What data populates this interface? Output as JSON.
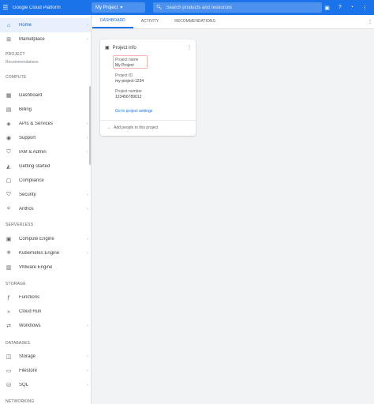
{
  "topbar": {
    "menu_icon": "hamburger-icon",
    "brand": "Google Cloud Platform",
    "project": "My Project",
    "search_placeholder": "Search products and resources",
    "icons": [
      "gift-icon",
      "help-icon",
      "bell-icon",
      "more-icon"
    ]
  },
  "sidebar": {
    "top": [
      {
        "label": "Home",
        "icon": "home-icon",
        "active": true
      },
      {
        "label": "Marketplace",
        "icon": "cart-icon",
        "active": false
      }
    ],
    "project_section": {
      "label": "PROJECT",
      "sub": "Recommendations"
    },
    "compute_label": "COMPUTE",
    "compute": [
      {
        "label": "Dashboard",
        "icon": "grid-icon"
      },
      {
        "label": "Billing",
        "icon": "billing-icon"
      },
      {
        "label": "APIs & Services",
        "icon": "api-icon"
      },
      {
        "label": "Support",
        "icon": "support-icon"
      },
      {
        "label": "IAM & Admin",
        "icon": "shield-icon"
      },
      {
        "label": "Getting started",
        "icon": "rocket-icon"
      },
      {
        "label": "Compliance",
        "icon": "check-icon"
      },
      {
        "label": "Security",
        "icon": "lock-icon"
      },
      {
        "label": "Anthos",
        "icon": "anthos-icon"
      }
    ],
    "serverless_label": "SERVERLESS",
    "serverless": [
      {
        "label": "Compute Engine",
        "icon": "chip-icon"
      },
      {
        "label": "Kubernetes Engine",
        "icon": "cluster-icon"
      },
      {
        "label": "VMware Engine",
        "icon": "server-icon"
      }
    ],
    "storage_label": "STORAGE",
    "storage": [
      {
        "label": "Functions",
        "icon": "function-icon"
      },
      {
        "label": "Cloud Run",
        "icon": "run-icon"
      },
      {
        "label": "Workflows",
        "icon": "flow-icon"
      }
    ],
    "databases_label": "DATABASES",
    "databases": [
      {
        "label": "Storage",
        "icon": "bucket-icon"
      },
      {
        "label": "Filestore",
        "icon": "folder-icon"
      },
      {
        "label": "SQL",
        "icon": "database-icon"
      }
    ],
    "networking_label": "NETWORKING"
  },
  "toolbar": {
    "tabs": [
      "DASHBOARD",
      "ACTIVITY",
      "RECOMMENDATIONS"
    ],
    "active_tab": 0
  },
  "card": {
    "title": "Project info",
    "project_name_label": "Project name",
    "project_name": "My Project",
    "project_id_label": "Project ID",
    "project_id": "my-project-1234",
    "project_number_label": "Project number",
    "project_number": "123456789012",
    "link": "Go to project settings",
    "footer": "Add people to this project"
  }
}
